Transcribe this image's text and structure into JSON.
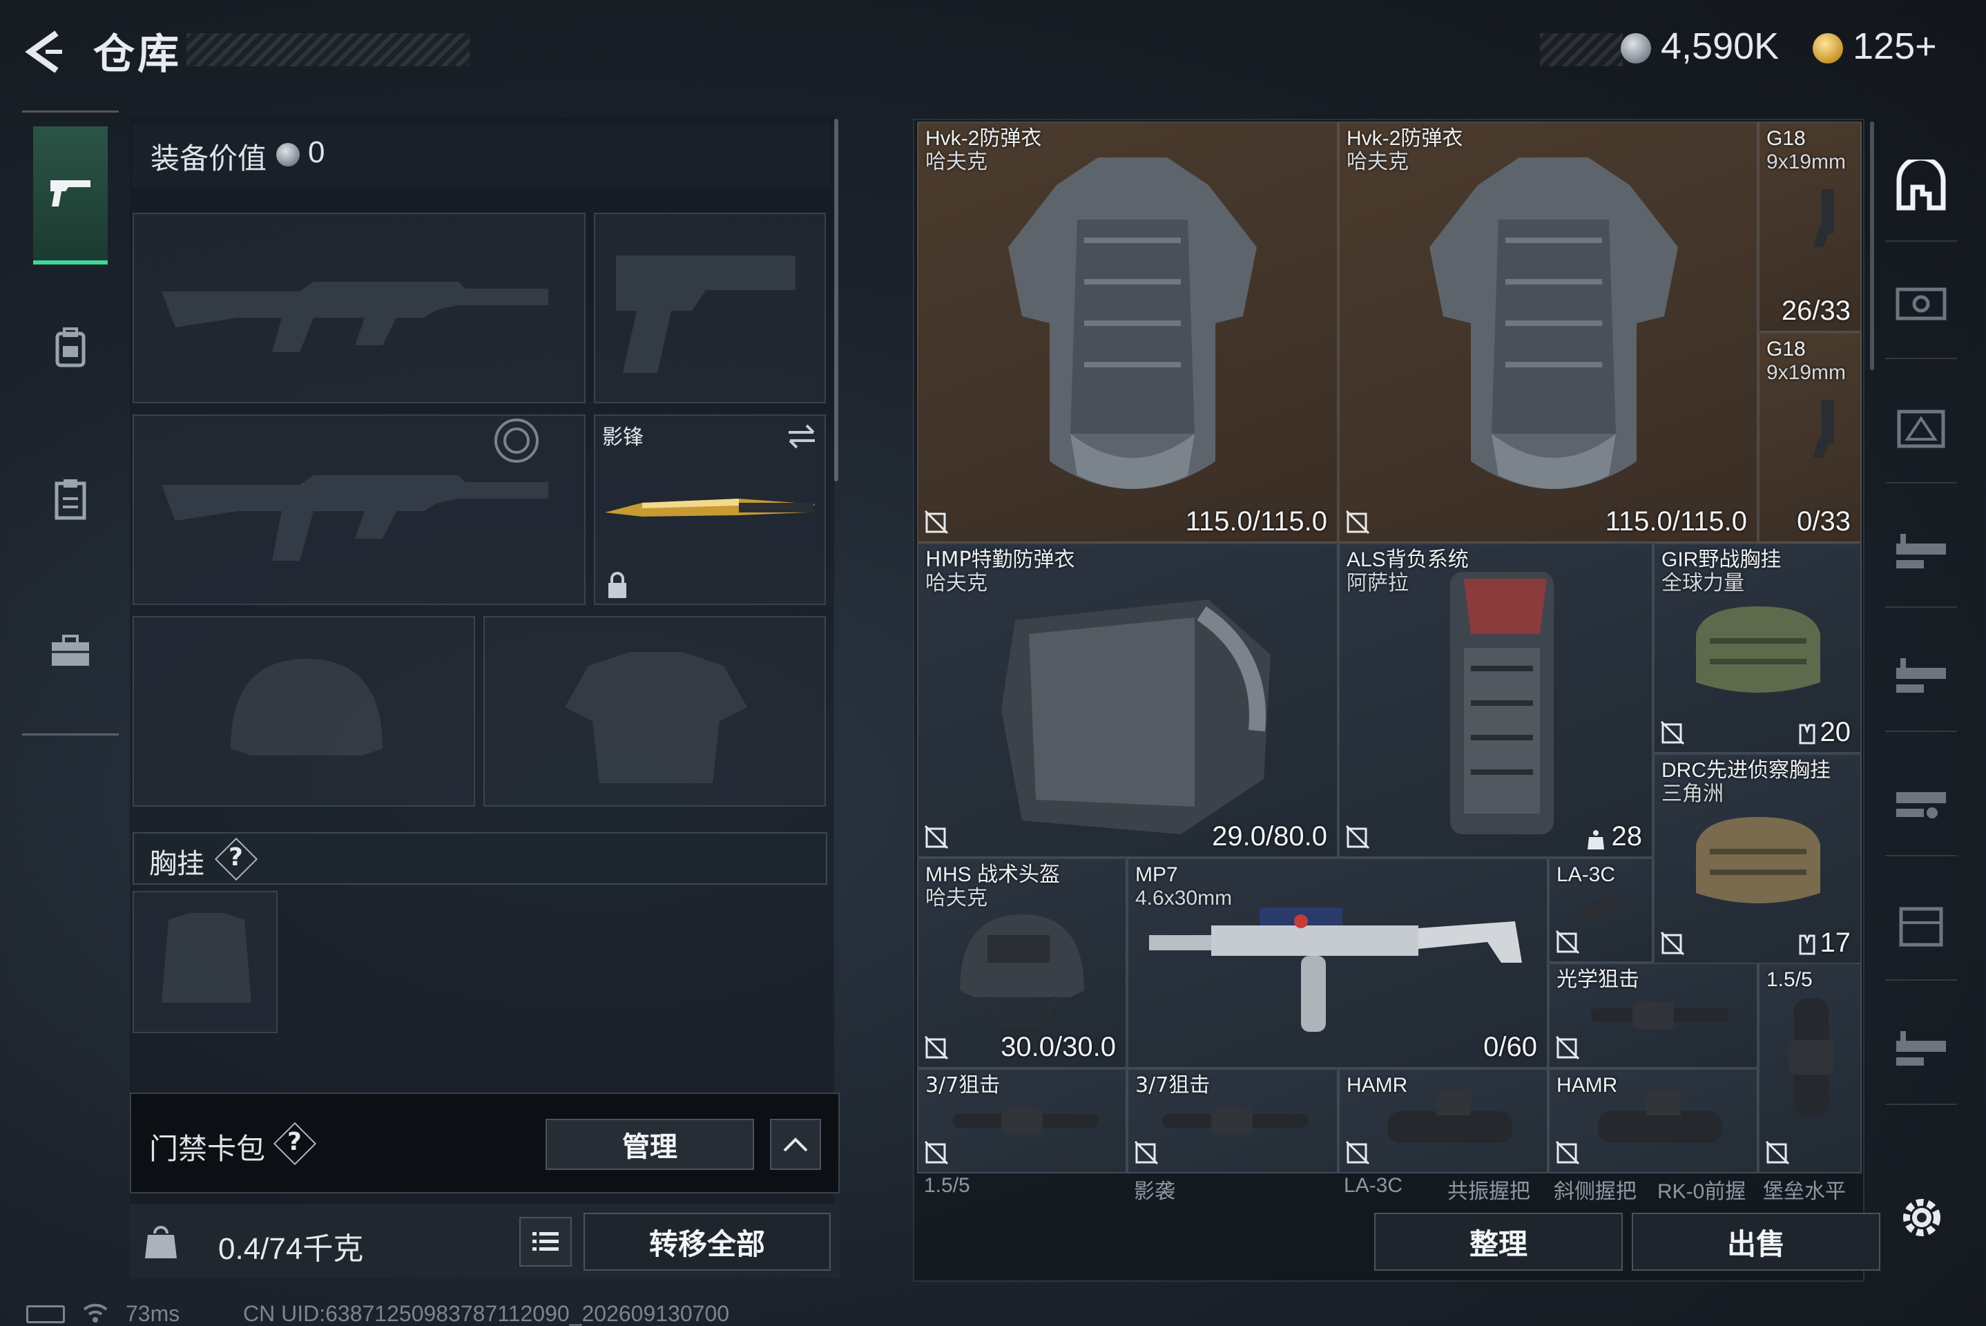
{
  "header": {
    "title": "仓库",
    "money": "4,590K",
    "premium": "125+"
  },
  "left_nav": {
    "tabs": [
      {
        "id": "weapons",
        "icon": "pistol-icon",
        "active": true
      },
      {
        "id": "backpack",
        "icon": "backpack-icon",
        "active": false
      },
      {
        "id": "clipboard",
        "icon": "clipboard-icon",
        "active": false
      },
      {
        "id": "briefcase",
        "icon": "briefcase-icon",
        "active": false
      }
    ]
  },
  "loadout": {
    "equip_value_label": "装备价值",
    "equip_value": "0",
    "melee_name": "影锋",
    "vest_label": "胸挂",
    "keycard_label": "门禁卡包",
    "manage_label": "管理",
    "weight": "0.4/74千克",
    "transfer_all_label": "转移全部"
  },
  "stash": {
    "items": {
      "armor1": {
        "name": "Hvk-2防弹衣",
        "maker": "哈夫克",
        "value": "115.0/115.0"
      },
      "armor2": {
        "name": "Hvk-2防弹衣",
        "maker": "哈夫克",
        "value": "115.0/115.0"
      },
      "g18a": {
        "name": "G18",
        "maker": "9x19mm",
        "value": "26/33"
      },
      "g18b": {
        "name": "G18",
        "maker": "9x19mm",
        "value": "0/33"
      },
      "hmp": {
        "name": "HMP特勤防弹衣",
        "maker": "哈夫克",
        "value": "29.0/80.0"
      },
      "als": {
        "name": "ALS背负系统",
        "maker": "阿萨拉",
        "value": "28"
      },
      "gir": {
        "name": "GIR野战胸挂",
        "maker": "全球力量",
        "value": "20"
      },
      "drc": {
        "name": "DRC先进侦察胸挂",
        "maker": "三角洲",
        "value": "17"
      },
      "mhs": {
        "name": "MHS 战术头盔",
        "maker": "哈夫克",
        "value": "30.0/30.0"
      },
      "mp7": {
        "name": "MP7",
        "maker": "4.6x30mm",
        "value": "0/60"
      },
      "la3c": {
        "name": "LA-3C",
        "maker": "",
        "value": ""
      },
      "optic_sniper": {
        "name": "光学狙击",
        "maker": "",
        "value": ""
      },
      "scope15": {
        "name": "1.5/5",
        "maker": "",
        "value": ""
      },
      "sniper37a": {
        "name": "3/7狙击",
        "maker": "",
        "value": ""
      },
      "sniper37b": {
        "name": "3/7狙击",
        "maker": "",
        "value": ""
      },
      "hamr1": {
        "name": "HAMR",
        "maker": "",
        "value": ""
      },
      "hamr2": {
        "name": "HAMR",
        "maker": "",
        "value": ""
      }
    },
    "cut_row": [
      "1.5/5",
      "影袭",
      "LA-3C",
      "共振握把",
      "斜侧握把",
      "RK-0前握",
      "堡垒水平"
    ],
    "sort_label": "整理",
    "sell_label": "出售"
  },
  "status": {
    "ping": "73ms",
    "uid": "CN UID:63871250983787112090_202609130700"
  },
  "colors": {
    "accent_green": "#3fd69a",
    "armor_bg": "#4b3b2e",
    "cell_bg": "#2b3440"
  }
}
